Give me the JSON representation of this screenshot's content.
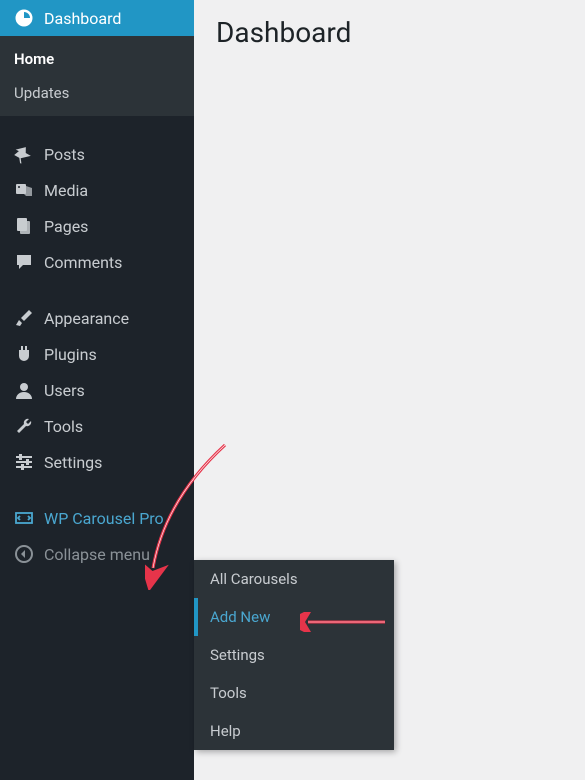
{
  "main": {
    "page_title": "Dashboard"
  },
  "sidebar": {
    "dashboard": {
      "label": "Dashboard"
    },
    "dashboard_sub": {
      "home": "Home",
      "updates": "Updates"
    },
    "posts": {
      "label": "Posts"
    },
    "media": {
      "label": "Media"
    },
    "pages": {
      "label": "Pages"
    },
    "comments": {
      "label": "Comments"
    },
    "appearance": {
      "label": "Appearance"
    },
    "plugins": {
      "label": "Plugins"
    },
    "users": {
      "label": "Users"
    },
    "tools": {
      "label": "Tools"
    },
    "settings": {
      "label": "Settings"
    },
    "carousel": {
      "label": "WP Carousel Pro"
    },
    "collapse": {
      "label": "Collapse menu"
    }
  },
  "flyout": {
    "all_carousels": "All Carousels",
    "add_new": "Add New",
    "settings": "Settings",
    "tools": "Tools",
    "help": "Help"
  }
}
